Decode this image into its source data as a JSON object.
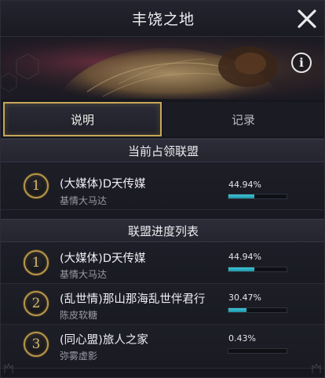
{
  "window": {
    "title": "丰饶之地"
  },
  "tabs": [
    {
      "label": "说明",
      "active": true
    },
    {
      "label": "记录",
      "active": false
    }
  ],
  "current_section": {
    "header": "当前占领联盟",
    "entry": {
      "rank": "1",
      "alliance": "(大媒体)D天传媒",
      "leader": "基情大马达",
      "percent_text": "44.94%",
      "progress": 0.4494
    }
  },
  "progress_section": {
    "header": "联盟进度列表",
    "rows": [
      {
        "rank": "1",
        "alliance": "(大媒体)D天传媒",
        "leader": "基情大马达",
        "percent_text": "44.94%",
        "progress": 0.4494
      },
      {
        "rank": "2",
        "alliance": "(乱世情)那山那海乱世伴君行",
        "leader": "陈皮软糖",
        "percent_text": "30.47%",
        "progress": 0.3047
      },
      {
        "rank": "3",
        "alliance": "(同心盟)旅人之家",
        "leader": "弥雾虚影",
        "percent_text": "0.43%",
        "progress": 0.0043
      }
    ]
  },
  "icons": {
    "close": "close-icon",
    "info": "info-icon"
  },
  "colors": {
    "accent_gold": "#c8a659",
    "progress_cyan": "#2fb3c6",
    "panel_bg": "#1a1b23"
  }
}
